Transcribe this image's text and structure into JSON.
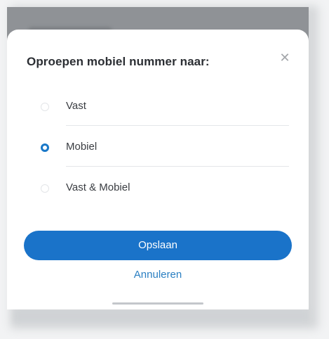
{
  "dialog": {
    "title": "Oproepen mobiel nummer naar:",
    "close_icon": "close-icon",
    "close_glyph": "✕"
  },
  "options": [
    {
      "label": "Vast",
      "selected": false
    },
    {
      "label": "Mobiel",
      "selected": true
    },
    {
      "label": "Vast & Mobiel",
      "selected": false
    }
  ],
  "actions": {
    "save_label": "Opslaan",
    "cancel_label": "Annuleren"
  },
  "colors": {
    "accent": "#1a73c9",
    "link": "#2a7fc2",
    "overlay": "#8f9296"
  }
}
